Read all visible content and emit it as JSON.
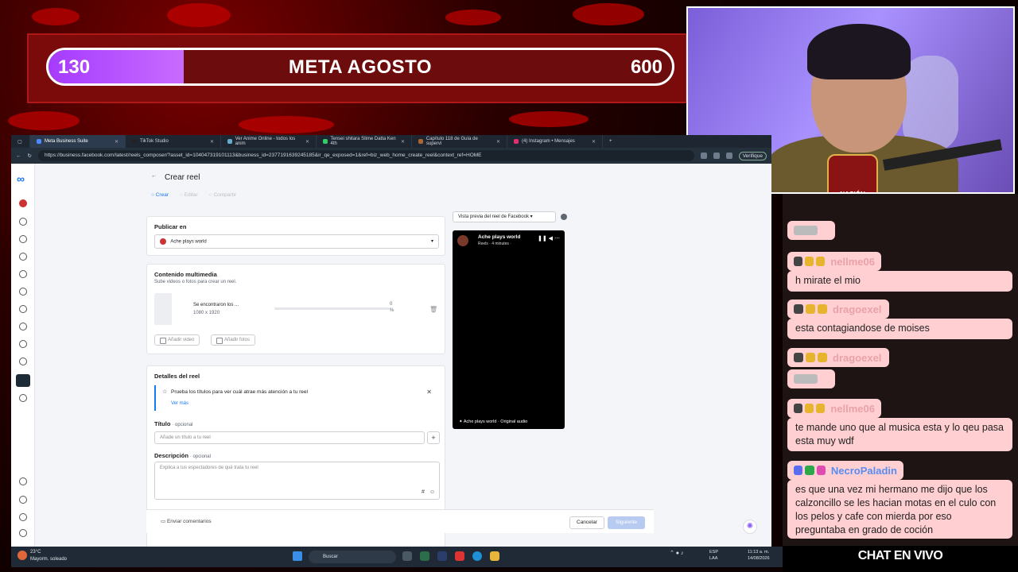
{
  "goal": {
    "current": "130",
    "title": "META AGOSTO",
    "target": "600",
    "progress": 0.217
  },
  "chat": {
    "messages": [
      {
        "kind": "emote"
      },
      {
        "user": "nellme06",
        "text": "h mirate el mio"
      },
      {
        "user": "dragoexel",
        "text": "esta contagiandose de moises"
      },
      {
        "user": "dragoexel",
        "text": ""
      },
      {
        "user": "nellme06",
        "text": "te mande uno que al musica esta y lo qeu pasa esta muy wdf"
      },
      {
        "user": "NecroPaladin",
        "text": "es que una vez mi hermano me dijo que los calzoncillo se les hacian motas en el culo con los pelos y cafe con mierda por eso preguntaba en grado de coción"
      }
    ],
    "footer": "CHAT EN VIVO"
  },
  "browser": {
    "tabs": [
      {
        "label": "Meta Business Suite",
        "active": true
      },
      {
        "label": "TikTok Studio",
        "active": false
      },
      {
        "label": "Ver Anime Online - todos los anim",
        "active": false
      },
      {
        "label": "Tensei shitara Slime Datta Ken 4th",
        "active": false
      },
      {
        "label": "Capítulo 118 de Guía de supervi",
        "active": false
      },
      {
        "label": "(4) Instagram • Mensajes",
        "active": false
      }
    ],
    "url": "https://business.facebook.com/latest/reels_composer/?asset_id=104047319101113&business_id=2377191639245185&ir_qe_exposed=1&ref=biz_web_home_create_reel&context_ref=HOME",
    "verify": "Verifique"
  },
  "page": {
    "title": "Crear reel",
    "steps": [
      "Crear",
      "Editar",
      "Compartir"
    ],
    "publish": {
      "label": "Publicar en",
      "account": "Ache plays world"
    },
    "media": {
      "label": "Contenido multimedia",
      "sub": "Sube videos o fotos para crear un reel.",
      "file_name": "Se encontraron los ...",
      "resolution": "1080 x 1920",
      "progress_num": "0",
      "progress_pct": "%",
      "add_video": "Añadir video",
      "add_photos": "Añadir fotos"
    },
    "details": {
      "label": "Detalles del reel",
      "tip": "Prueba los títulos para ver cuál atrae más atención a tu reel",
      "see_more": "Ver más",
      "title_label": "Título",
      "optional": "· opcional",
      "title_placeholder": "Añade un título a tu reel",
      "desc_label": "Descripción",
      "desc_placeholder": "Explica a tus espectadores de qué trata tu reel"
    },
    "preview": {
      "selector": "Vista previa del reel de Facebook",
      "account": "Ache plays world",
      "meta": "Reels · 4 minutes · ",
      "audio": "Ache plays world · Original audio"
    },
    "footer": {
      "feedback": "Enviar comentarios",
      "cancel": "Cancelar",
      "next": "Siguiente"
    }
  },
  "taskbar": {
    "weather_temp": "23°C",
    "weather_desc": "Mayorm. soleado",
    "search": "Buscar",
    "lang_top": "ESP",
    "lang_bottom": "LAA",
    "time": "11:13 a. m.",
    "date": "14/08/2026"
  }
}
